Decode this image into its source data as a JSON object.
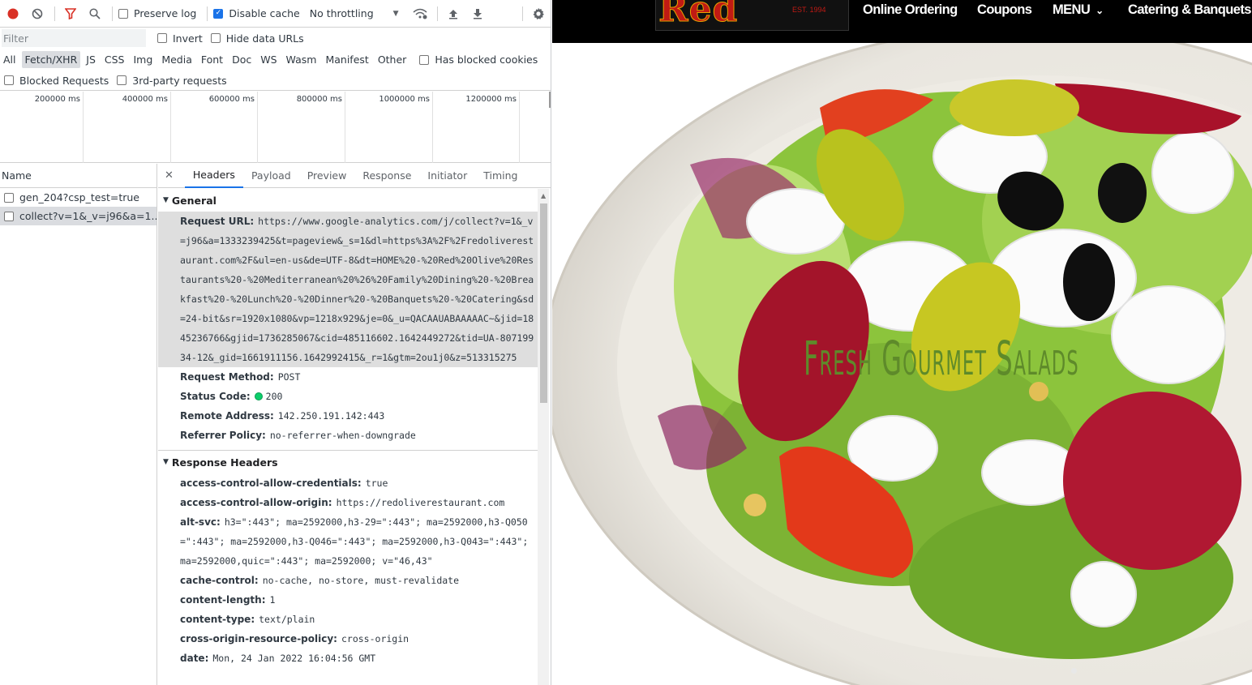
{
  "toolbar": {
    "preserve_log": "Preserve log",
    "disable_cache": "Disable cache",
    "throttling": "No throttling"
  },
  "filterbar": {
    "placeholder": "Filter",
    "invert": "Invert",
    "hide_data_urls": "Hide data URLs",
    "types": [
      "All",
      "Fetch/XHR",
      "JS",
      "CSS",
      "Img",
      "Media",
      "Font",
      "Doc",
      "WS",
      "Wasm",
      "Manifest",
      "Other"
    ],
    "active_type": "Fetch/XHR",
    "has_blocked_cookies": "Has blocked cookies",
    "blocked_requests": "Blocked Requests",
    "third_party": "3rd-party requests"
  },
  "overview": {
    "ticks": [
      "200000 ms",
      "400000 ms",
      "600000 ms",
      "800000 ms",
      "1000000 ms",
      "1200000 ms"
    ]
  },
  "requests": {
    "header": "Name",
    "rows": [
      "gen_204?csp_test=true",
      "collect?v=1&_v=j96&a=1..."
    ]
  },
  "details": {
    "tabs": [
      "Headers",
      "Payload",
      "Preview",
      "Response",
      "Initiator",
      "Timing"
    ],
    "active_tab": "Headers",
    "general_title": "General",
    "general": [
      {
        "k": "Request URL:",
        "v": "https://www.google-analytics.com/j/collect?v=1&_v=j96&a=1333239425&t=pageview&_s=1&dl=https%3A%2F%2Fredoliverestaurant.com%2F&ul=en-us&de=UTF-8&dt=HOME%20-%20Red%20Olive%20Restaurants%20-%20Mediterranean%20%26%20Family%20Dining%20-%20Breakfast%20-%20Lunch%20-%20Dinner%20-%20Banquets%20-%20Catering&sd=24-bit&sr=1920x1080&vp=1218x929&je=0&_u=QACAAUABAAAAAC~&jid=1845236766&gjid=1736285067&cid=485116602.1642449272&tid=UA-80719934-12&_gid=1661911156.1642992415&_r=1&gtm=2ou1j0&z=513315275"
      },
      {
        "k": "Request Method:",
        "v": "POST"
      },
      {
        "k": "Status Code:",
        "v": "200"
      },
      {
        "k": "Remote Address:",
        "v": "142.250.191.142:443"
      },
      {
        "k": "Referrer Policy:",
        "v": "no-referrer-when-downgrade"
      }
    ],
    "response_title": "Response Headers",
    "response": [
      {
        "k": "access-control-allow-credentials:",
        "v": "true"
      },
      {
        "k": "access-control-allow-origin:",
        "v": "https://redoliverestaurant.com"
      },
      {
        "k": "alt-svc:",
        "v": "h3=\":443\"; ma=2592000,h3-29=\":443\"; ma=2592000,h3-Q050=\":443\"; ma=2592000,h3-Q046=\":443\"; ma=2592000,h3-Q043=\":443\"; ma=2592000,quic=\":443\"; ma=2592000; v=\"46,43\""
      },
      {
        "k": "cache-control:",
        "v": "no-cache, no-store, must-revalidate"
      },
      {
        "k": "content-length:",
        "v": "1"
      },
      {
        "k": "content-type:",
        "v": "text/plain"
      },
      {
        "k": "cross-origin-resource-policy:",
        "v": "cross-origin"
      },
      {
        "k": "date:",
        "v": "Mon, 24 Jan 2022 16:04:56 GMT"
      }
    ]
  },
  "site": {
    "logo": "Red Olive",
    "logo_tag": "EST. 1994",
    "nav": [
      "Online Ordering",
      "Coupons",
      "MENU",
      "Catering & Banquets"
    ],
    "headline": "Fresh Gourmet Salads"
  }
}
